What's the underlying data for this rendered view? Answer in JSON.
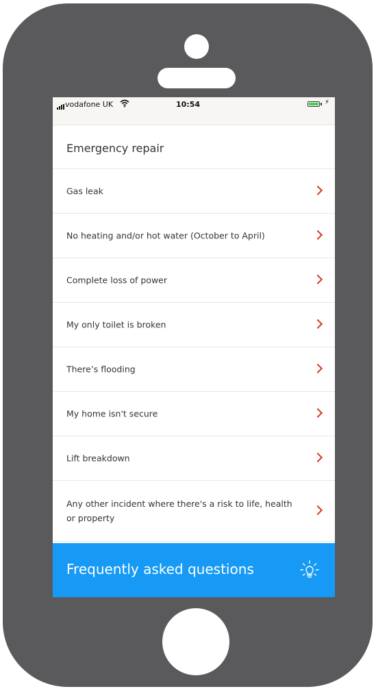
{
  "status_bar": {
    "carrier": "vodafone UK",
    "time": "10:54",
    "battery_level": 1.0,
    "wifi_icon": "wifi-icon",
    "charging_icon": "charging-bolt-icon"
  },
  "header": {
    "title": "Emergency repair"
  },
  "repair_options": [
    {
      "label": "Gas leak"
    },
    {
      "label": "No heating and/or hot water (October to April)"
    },
    {
      "label": "Complete loss of power"
    },
    {
      "label": "My only toilet is broken"
    },
    {
      "label": "There’s flooding"
    },
    {
      "label": "My home isn't secure"
    },
    {
      "label": "Lift breakdown"
    },
    {
      "label": "Any other incident where there's a risk to life, health or property"
    }
  ],
  "faq": {
    "label": "Frequently asked questions",
    "icon": "lightbulb-icon"
  },
  "colors": {
    "phone_body": "#5a5a5c",
    "accent_blue": "#169af5",
    "chevron_red": "#d93a26",
    "battery_green": "#3fd15a"
  }
}
